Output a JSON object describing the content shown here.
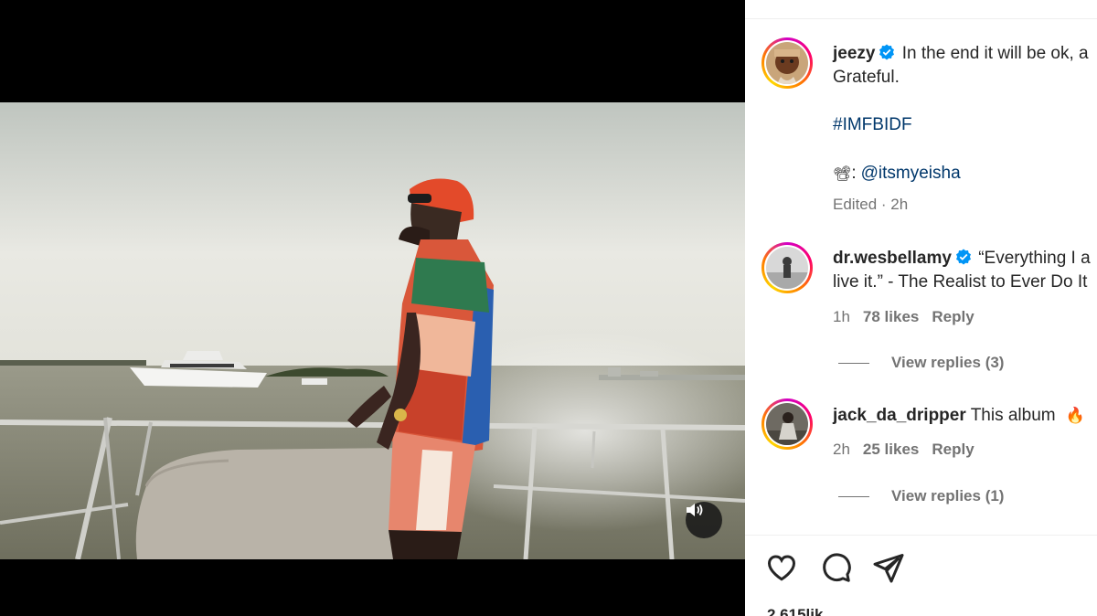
{
  "post": {
    "author": "jeezy",
    "caption_line1": "In the end it will be ok, a",
    "caption_line2": "Grateful.",
    "hashtag": "#IMFBIDF",
    "credit_emoji": "📽",
    "credit_separator": ":",
    "credit_handle": "@itsmyeisha",
    "edited": "Edited · 2h"
  },
  "comments": [
    {
      "username": "dr.wesbellamy",
      "verified": true,
      "text_line1": "“Everything I a",
      "text_line2": "live it.” - The Realist to Ever Do It",
      "time": "1h",
      "likes": "78 likes",
      "reply_label": "Reply",
      "view_replies": "View replies (3)"
    },
    {
      "username": "jack_da_dripper",
      "verified": false,
      "text": "This album",
      "emoji": "🔥",
      "time": "2h",
      "likes": "25 likes",
      "reply_label": "Reply",
      "view_replies": "View replies (1)"
    }
  ],
  "actions": [
    "heart-icon",
    "comment-icon",
    "share-icon"
  ],
  "likes_count_partial": "2,615lik",
  "colors": {
    "link": "#00376b",
    "verified": "#0095f6",
    "secondary_text": "#737373",
    "primary_text": "#262626"
  }
}
